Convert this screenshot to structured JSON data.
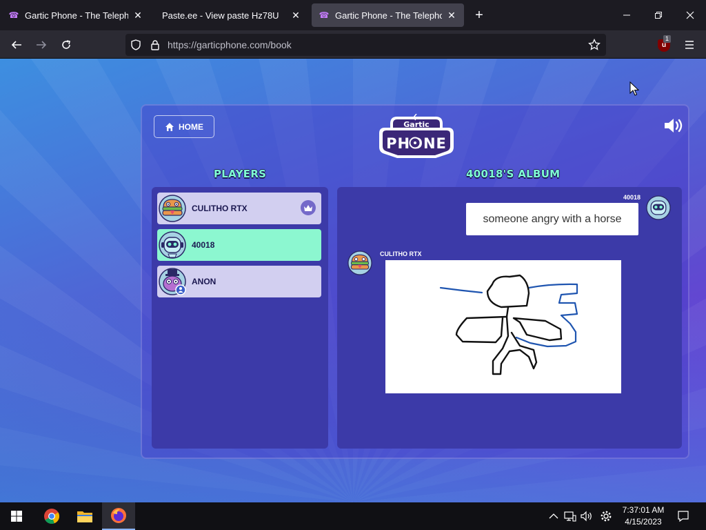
{
  "browser": {
    "tabs": [
      {
        "title": "Gartic Phone - The Telephone G",
        "favicon": "phone-icon",
        "active": false
      },
      {
        "title": "Paste.ee - View paste Hz78U",
        "favicon": "none",
        "active": false
      },
      {
        "title": "Gartic Phone - The Telephone G",
        "favicon": "phone-icon",
        "active": true
      }
    ],
    "url": "https://garticphone.com/book",
    "extension_badge": "1"
  },
  "game": {
    "home_label": "HOME",
    "logo_top": "Gartic",
    "logo_bottom": "PHONE",
    "players_title": "PLAYERS",
    "album_title": "40018'S ALBUM",
    "players": [
      {
        "name": "CULITHO RTX",
        "host": true,
        "me": false
      },
      {
        "name": "40018",
        "host": false,
        "me": true
      },
      {
        "name": "ANON",
        "host": false,
        "me": false
      }
    ],
    "album": {
      "phrase_author": "40018",
      "phrase": "someone angry with a horse",
      "drawing_author": "CULITHO RTX"
    }
  },
  "taskbar": {
    "time": "7:37:01 AM",
    "date": "4/15/2023"
  },
  "colors": {
    "accent_mint": "#8cf7d0",
    "title_mint": "#7fffd4",
    "panel": "#3c3aa8"
  }
}
